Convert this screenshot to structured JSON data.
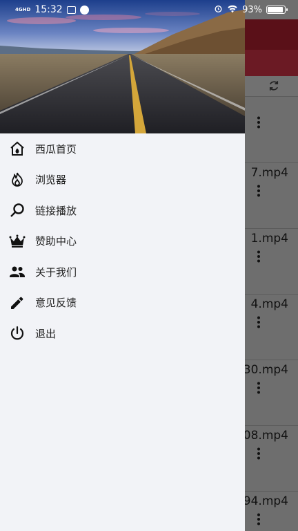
{
  "status_bar": {
    "network": "4GHD",
    "time": "15:32",
    "battery_percent": "93%",
    "battery_level": 0.93
  },
  "background_list": {
    "items": [
      {
        "name": ""
      },
      {
        "name": "7.mp4"
      },
      {
        "name": "1.mp4"
      },
      {
        "name": "4.mp4"
      },
      {
        "name": "30.mp4"
      },
      {
        "name": "08.mp4"
      },
      {
        "name": "94.mp4"
      },
      {
        "name": ""
      }
    ]
  },
  "drawer": {
    "menu": [
      {
        "label": "西瓜首页",
        "icon": "home-icon"
      },
      {
        "label": "浏览器",
        "icon": "flame-icon"
      },
      {
        "label": "链接播放",
        "icon": "search-icon"
      },
      {
        "label": "赞助中心",
        "icon": "crown-icon"
      },
      {
        "label": "关于我们",
        "icon": "people-icon"
      },
      {
        "label": "意见反馈",
        "icon": "pencil-icon"
      },
      {
        "label": "退出",
        "icon": "power-icon"
      }
    ]
  }
}
